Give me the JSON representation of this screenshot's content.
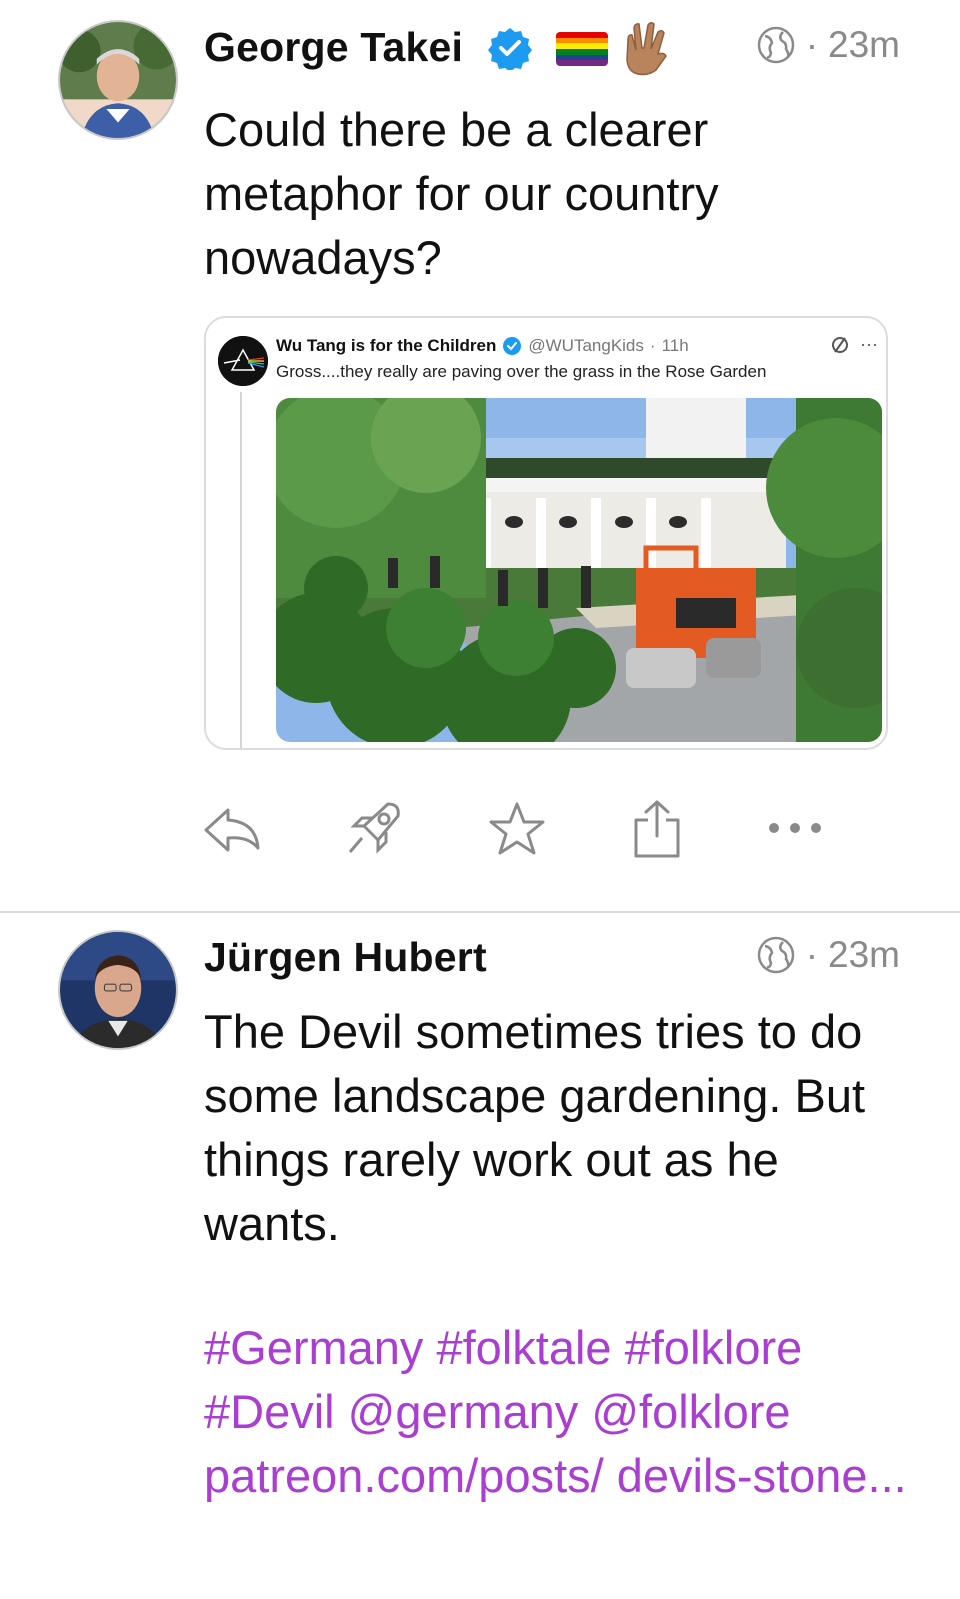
{
  "posts": [
    {
      "author": "George Takei",
      "time": "23m",
      "body": "Could there be a clearer metaphor for our country nowadays?",
      "emoji": [
        "verified-badge",
        "rainbow-flag",
        "vulcan-salute-hand"
      ],
      "quote": {
        "author": "Wu Tang is for the Children",
        "handle": "@WUTangKids",
        "sep": "·",
        "time": "11h",
        "text": "Gross....they really are paving over the grass in the Rose Garden",
        "more": "···",
        "image": "rose-garden-paving-photo"
      },
      "actions": {
        "reply_count": "",
        "boost_count": "",
        "icons": [
          "reply-icon",
          "boost-icon",
          "favourite-icon",
          "share-icon",
          "more-icon"
        ]
      }
    },
    {
      "author": "Jürgen Hubert",
      "time": "23m",
      "body": "The Devil sometimes tries to do some landscape gardening. But things rarely work out as he wants.",
      "tags": [
        "#Germany",
        "#folktale",
        "#folklore",
        "#Devil",
        "@germany",
        "@folklore",
        "patreon.com/posts/ devils-stone..."
      ]
    }
  ],
  "meta_sep": "·",
  "colors": {
    "link": "#a93ed1",
    "muted": "#8a8a8a",
    "verified": "#1d9bf0"
  }
}
